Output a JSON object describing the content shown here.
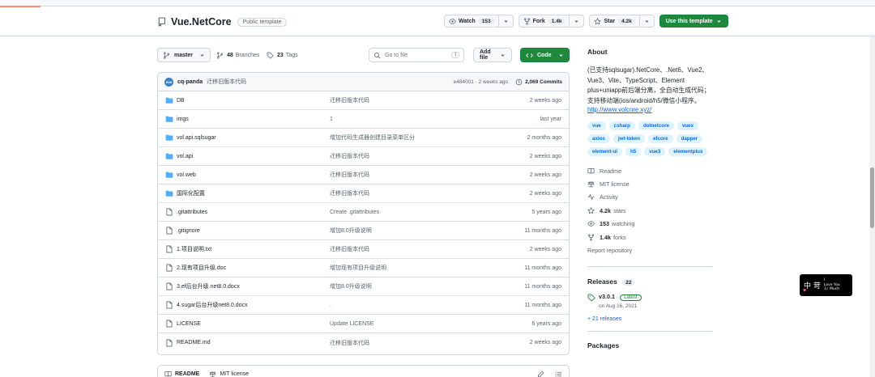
{
  "repo": {
    "name": "Vue.NetCore",
    "badge": "Public template"
  },
  "header": {
    "watch_label": "Watch",
    "watch_count": "153",
    "fork_label": "Fork",
    "fork_count": "1.4k",
    "star_label": "Star",
    "star_count": "4.2k",
    "use_template_label": "Use this template"
  },
  "toolbar": {
    "branch": "master",
    "branches_count": "48",
    "branches_label": "Branches",
    "tags_count": "23",
    "tags_label": "Tags",
    "goto_placeholder": "Go to file",
    "goto_key": "t",
    "add_file_label": "Add file",
    "code_label": "Code"
  },
  "commit": {
    "avatar_text": "vue",
    "author": "cq-panda",
    "message": "迁移旧版本代码",
    "hash_time": "e484001 · 2 weeks ago",
    "count": "2,069 Commits"
  },
  "files": [
    {
      "type": "dir",
      "name": "DB",
      "message": "迁移旧版本代码",
      "date": "2 weeks ago"
    },
    {
      "type": "dir",
      "name": "imgs",
      "message": "1",
      "date": "last year"
    },
    {
      "type": "dir",
      "name": "vol.api.sqlsugar",
      "message": "增加代码生成器创建目录菜单区分",
      "date": "2 months ago"
    },
    {
      "type": "dir",
      "name": "vol.api",
      "message": "迁移旧版本代码",
      "date": "2 weeks ago"
    },
    {
      "type": "dir",
      "name": "vol.web",
      "message": "迁移旧版本代码",
      "date": "2 weeks ago"
    },
    {
      "type": "dir",
      "name": "国际化配置",
      "message": "迁移旧版本代码",
      "date": "2 weeks ago"
    },
    {
      "type": "file",
      "name": ".gitattributes",
      "message": "Create .gitattributes",
      "date": "5 years ago"
    },
    {
      "type": "file",
      "name": ".gitignore",
      "message": "增加8.0升级说明",
      "date": "11 months ago"
    },
    {
      "type": "file",
      "name": "1.项目说明.txt",
      "message": "迁移旧版本代码",
      "date": "2 weeks ago"
    },
    {
      "type": "file",
      "name": "2.现有项目升级.doc",
      "message": "增加现有项目升级说明",
      "date": "11 months ago"
    },
    {
      "type": "file",
      "name": "3.ef后台升级.net8.0.docx",
      "message": "增加8.0升级说明",
      "date": "11 months ago"
    },
    {
      "type": "file",
      "name": "4.sugar后台升级net8.0.docx",
      "message": ".",
      "date": "11 months ago"
    },
    {
      "type": "file",
      "name": "LICENSE",
      "message": "Update LICENSE",
      "date": "6 years ago"
    },
    {
      "type": "file",
      "name": "README.md",
      "message": "迁移旧版本代码",
      "date": "2 weeks ago"
    }
  ],
  "readme_bar": {
    "readme_tab": "README",
    "license_tab": "MIT license"
  },
  "about": {
    "title": "About",
    "description": "(已支持sqlsugar).NetCore、.Net6、Vue2、Vue3、Vite、TypeScript、Element plus+uniapp前后端分离，全自动生成代码；支持移动端(ios/android/h5/微信小程序。",
    "link": "http://www.volcore.xyz/",
    "topics": [
      "vue",
      "csharp",
      "dotnetcore",
      "vuex",
      "axios",
      "jwt-token",
      "efcore",
      "dapper",
      "element-ui",
      "h5",
      "vue3",
      "elementplus"
    ],
    "readme": "Readme",
    "license": "MIT license",
    "activity": "Activity",
    "stars_count": "4.2k",
    "stars_label": "stars",
    "watching_count": "153",
    "watching_label": "watching",
    "forks_count": "1.4k",
    "forks_label": "forks",
    "report": "Report repository"
  },
  "releases": {
    "title": "Releases",
    "count": "22",
    "latest_tag": "v3.0.1",
    "latest_badge": "Latest",
    "latest_date": "on Aug 16, 2021",
    "more": "+ 21 releases"
  },
  "packages": {
    "title": "Packages"
  },
  "widget": {
    "big": "中 苛",
    "small_line1": "I",
    "small_line2": "Love You",
    "small_line3": "3♪ Much"
  },
  "colors": {
    "accent_green": "#1f883d",
    "link_blue": "#0969da",
    "folder_blue": "#54aeff",
    "topic_bg": "#ddf4ff"
  }
}
